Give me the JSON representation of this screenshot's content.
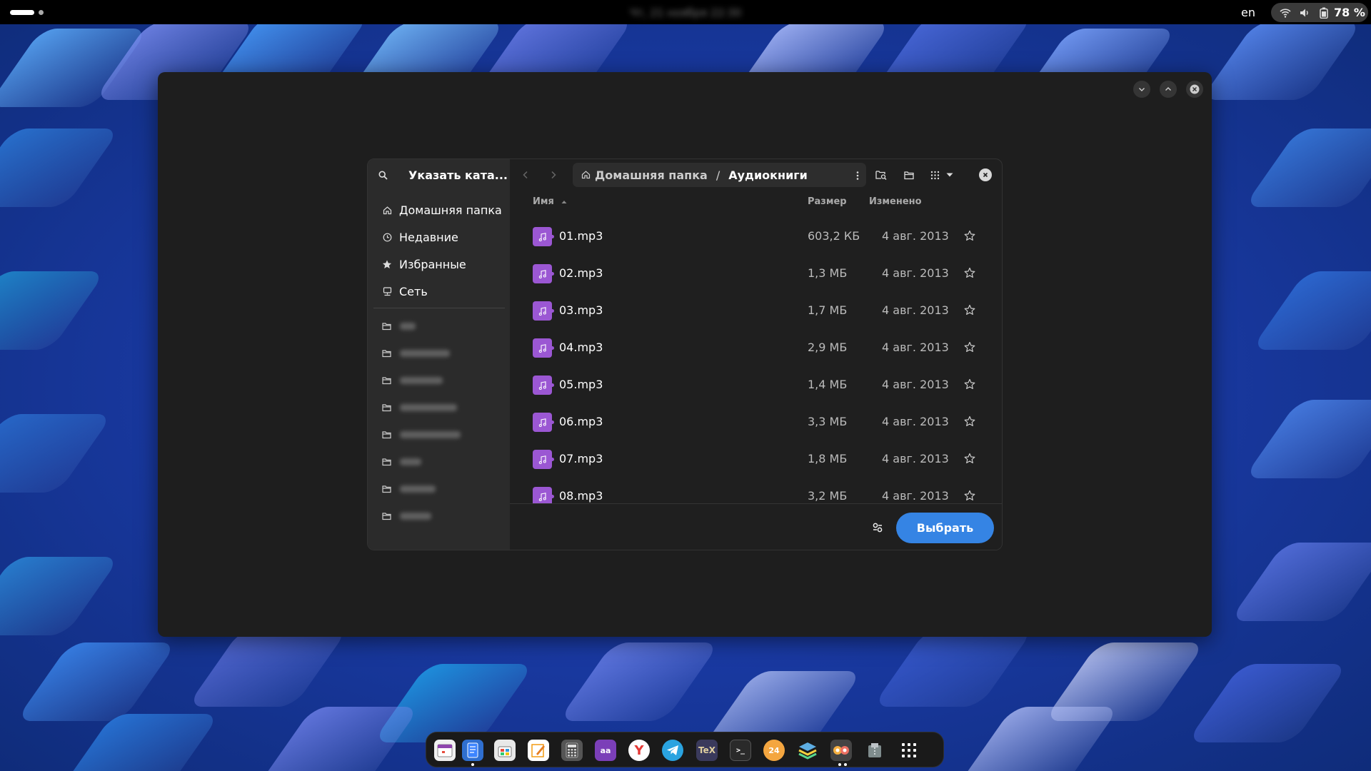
{
  "topbar": {
    "clock": "Чт, 21 ноября 22:30",
    "language": "en",
    "battery": "78 %"
  },
  "dialog": {
    "sidebar_title": "Указать ката...",
    "places": [
      {
        "label": "Домашняя папка",
        "icon": "home-icon"
      },
      {
        "label": "Недавние",
        "icon": "clock-icon"
      },
      {
        "label": "Избранные",
        "icon": "star-icon"
      },
      {
        "label": "Сеть",
        "icon": "network-icon"
      }
    ],
    "path": {
      "home": "Домашняя папка",
      "separator": "/",
      "current": "Аудиокниги"
    },
    "columns": {
      "name": "Имя",
      "size": "Размер",
      "modified": "Изменено"
    },
    "files": [
      {
        "name": "01.mp3",
        "size": "603,2 КБ",
        "date": "4 авг. 2013"
      },
      {
        "name": "02.mp3",
        "size": "1,3 МБ",
        "date": "4 авг. 2013"
      },
      {
        "name": "03.mp3",
        "size": "1,7 МБ",
        "date": "4 авг. 2013"
      },
      {
        "name": "04.mp3",
        "size": "2,9 МБ",
        "date": "4 авг. 2013"
      },
      {
        "name": "05.mp3",
        "size": "1,4 МБ",
        "date": "4 авг. 2013"
      },
      {
        "name": "06.mp3",
        "size": "3,3 МБ",
        "date": "4 авг. 2013"
      },
      {
        "name": "07.mp3",
        "size": "1,8 МБ",
        "date": "4 авг. 2013"
      },
      {
        "name": "08.mp3",
        "size": "3,2 МБ",
        "date": "4 авг. 2013"
      }
    ],
    "select_label": "Выбрать"
  },
  "colors": {
    "accent": "#3584e4",
    "audio_icon": "#9b57d3",
    "window_bg": "#1e1e1e",
    "sidebar_bg": "#2b2b2b"
  }
}
